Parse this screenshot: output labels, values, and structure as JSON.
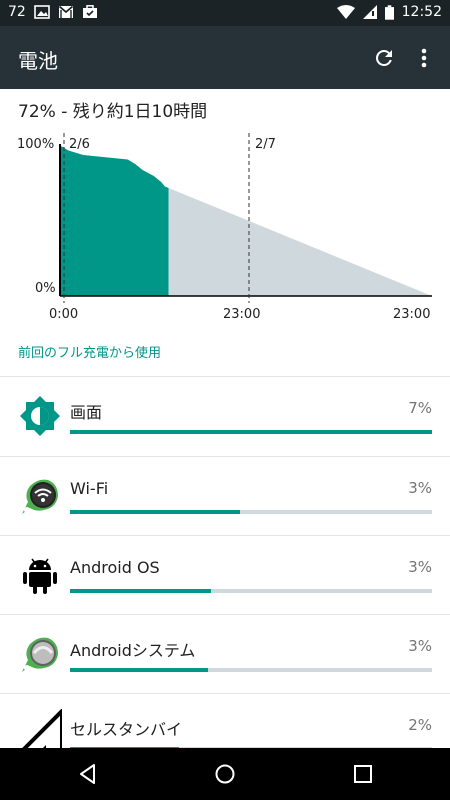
{
  "status_bar": {
    "notification_count": "72",
    "time": "12:52",
    "icons": [
      "image-icon",
      "gmail-icon",
      "briefcase-icon",
      "wifi-icon",
      "signal-icon",
      "battery-icon"
    ]
  },
  "app_bar": {
    "title": "電池",
    "icons": [
      "refresh-icon",
      "more-vert-icon"
    ]
  },
  "summary": "72% - 残り約1日10時間",
  "chart_data": {
    "type": "area",
    "y_labels": [
      "100%",
      "0%"
    ],
    "x_tick_labels": [
      "0:00",
      "23:00",
      "23:00"
    ],
    "date_markers": [
      "2/6",
      "2/7"
    ],
    "series": [
      {
        "name": "",
        "kind": "history",
        "color": "#009688",
        "points": [
          {
            "t": 0.0,
            "level": 100
          },
          {
            "t": 0.02,
            "level": 97
          },
          {
            "t": 0.06,
            "level": 94
          },
          {
            "t": 0.1,
            "level": 93
          },
          {
            "t": 0.14,
            "level": 92
          },
          {
            "t": 0.18,
            "level": 91
          },
          {
            "t": 0.2,
            "level": 88
          },
          {
            "t": 0.22,
            "level": 84
          },
          {
            "t": 0.25,
            "level": 80
          },
          {
            "t": 0.27,
            "level": 76
          },
          {
            "t": 0.28,
            "level": 73
          },
          {
            "t": 0.29,
            "level": 72
          }
        ]
      },
      {
        "name": "",
        "kind": "prediction",
        "color": "#cfd8dc",
        "points": [
          {
            "t": 0.29,
            "level": 72
          },
          {
            "t": 1.0,
            "level": 0
          }
        ]
      }
    ]
  },
  "since_label": "前回のフル充電から使用",
  "usage_items": [
    {
      "name": "画面",
      "percent": "7%",
      "fill": 1.0,
      "icon": "brightness-icon"
    },
    {
      "name": "Wi-Fi",
      "percent": "3%",
      "fill": 0.47,
      "icon": "wifi-app-icon"
    },
    {
      "name": "Android OS",
      "percent": "3%",
      "fill": 0.39,
      "icon": "android-icon"
    },
    {
      "name": "Androidシステム",
      "percent": "3%",
      "fill": 0.38,
      "icon": "android-system-icon"
    },
    {
      "name": "セルスタンバイ",
      "percent": "2%",
      "fill": 0.3,
      "icon": "cell-signal-icon"
    }
  ],
  "nav_bar": {
    "icons": [
      "back-icon",
      "home-icon",
      "recents-icon"
    ]
  }
}
